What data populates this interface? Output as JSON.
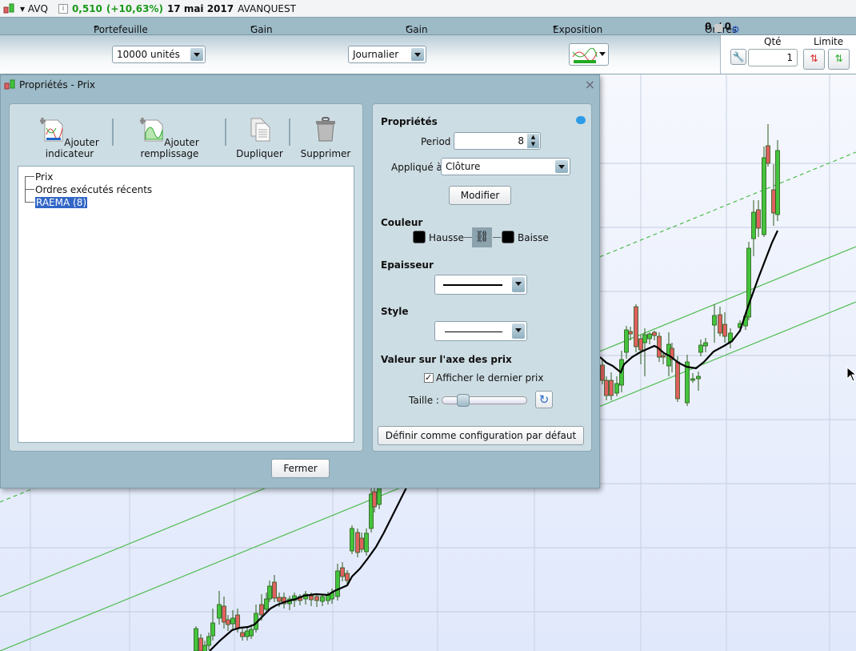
{
  "header": {
    "symbol": "AVQ",
    "price": "0,510",
    "change": "(+10,63%)",
    "date": "17 mai 2017",
    "name": "AVANQUEST"
  },
  "stats": {
    "portefeuille_label": "Portefeuille :",
    "portefeuille": "-",
    "gain_latent_label": "Gain latent :",
    "gain_latent": "-",
    "gain_jour_label": "Gain Jour :",
    "gain_jour": "-",
    "exposition_label": "Exposition :",
    "exposition": "-",
    "ordres_label": "Ordres :",
    "ordres_a": "0",
    "ordres_b": "/ 0"
  },
  "toolbar": {
    "quantity_select": "10000 unités",
    "period_select": "Journalier",
    "qty_label": "Qté",
    "qty_value": "1",
    "limit_label": "Limite"
  },
  "dialog": {
    "title": "Propriétés - Prix",
    "close": "×",
    "actions": [
      "Ajouter indicateur",
      "Ajouter remplissage",
      "Dupliquer",
      "Supprimer"
    ],
    "tree": [
      "Prix",
      "Ordres exécutés récents",
      "RAEMA (8)"
    ],
    "close_button": "Fermer",
    "props": {
      "title": "Propriétés",
      "period_label": "Period",
      "period_value": "8",
      "applied_label": "Appliqué à",
      "applied_value": "Clôture",
      "modify": "Modifier",
      "color_title": "Couleur",
      "up": "Hausse",
      "down": "Baisse",
      "thickness_title": "Epaisseur",
      "style_title": "Style",
      "axis_title": "Valeur sur l'axe des prix",
      "show_last": "Afficher le dernier prix",
      "show_last_checked": true,
      "size_label": "Taille :",
      "size_slider": 0.2,
      "default_button": "Définir comme configuration par défaut"
    }
  },
  "colors": {
    "up": "#44c43c",
    "down": "#e06060",
    "ema": "#000000",
    "trend": "#4cbc4c",
    "selection": "#3166c6"
  }
}
